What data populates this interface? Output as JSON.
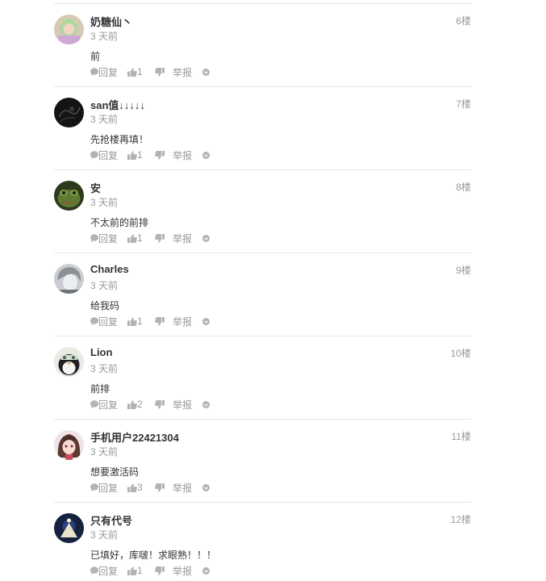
{
  "comments": [
    {
      "username": "奶糖仙丶",
      "time": "3 天前",
      "floor": "6楼",
      "content": "前",
      "reply_label": "回复",
      "likes": "1",
      "report_label": "举报",
      "avatar_icon": "cat-girl-avatar-icon"
    },
    {
      "username": "san值↓↓↓↓↓",
      "time": "3 天前",
      "floor": "7楼",
      "content": "先抢楼再填！",
      "reply_label": "回复",
      "likes": "1",
      "report_label": "举报",
      "avatar_icon": "dark-sketch-avatar-icon"
    },
    {
      "username": "安",
      "time": "3 天前",
      "floor": "8楼",
      "content": "不太前的前排",
      "reply_label": "回复",
      "likes": "1",
      "report_label": "举报",
      "avatar_icon": "frog-avatar-icon"
    },
    {
      "username": "Charles",
      "time": "3 天前",
      "floor": "9楼",
      "content": "给我码",
      "reply_label": "回复",
      "likes": "1",
      "report_label": "举报",
      "avatar_icon": "grey-hair-avatar-icon"
    },
    {
      "username": "Lion",
      "time": "3 天前",
      "floor": "10楼",
      "content": "前排",
      "reply_label": "回复",
      "likes": "2",
      "report_label": "举报",
      "avatar_icon": "penguin-avatar-icon"
    },
    {
      "username": "手机用户22421304",
      "time": "3 天前",
      "floor": "11楼",
      "content": "想要激活码",
      "reply_label": "回复",
      "likes": "3",
      "report_label": "举报",
      "avatar_icon": "anime-girl-avatar-icon"
    },
    {
      "username": "只有代号",
      "time": "3 天前",
      "floor": "12楼",
      "content": "已填好，库啵！求眼熟！！！",
      "reply_label": "回复",
      "likes": "1",
      "report_label": "举报",
      "avatar_icon": "navy-emblem-avatar-icon"
    }
  ],
  "colors": {
    "text_primary": "#333333",
    "text_muted": "#999999",
    "icon_grey": "#b3b3b3",
    "divider": "#e8e8e8"
  }
}
